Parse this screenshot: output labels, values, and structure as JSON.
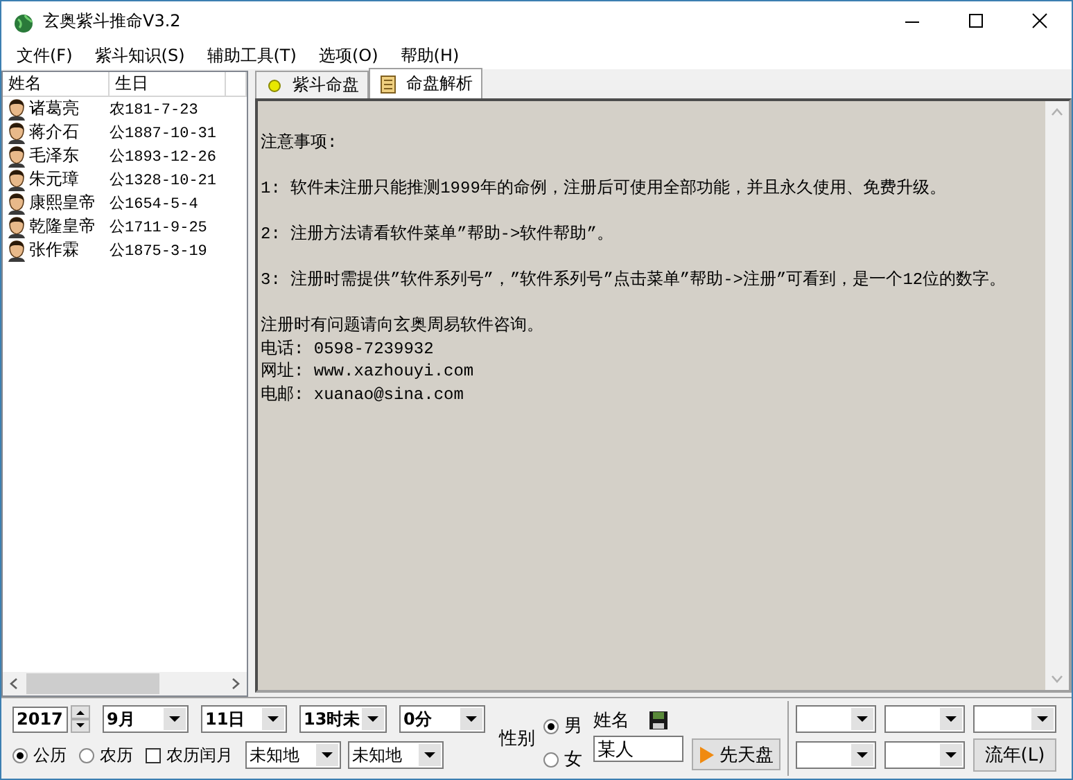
{
  "window": {
    "title": "玄奥紫斗推命V3.2"
  },
  "menu": [
    "文件(F)",
    "紫斗知识(S)",
    "辅助工具(T)",
    "选项(O)",
    "帮助(H)"
  ],
  "people_list": {
    "columns": [
      "姓名",
      "生日"
    ],
    "rows": [
      {
        "name": "诸葛亮",
        "birthday": "农181-7-23"
      },
      {
        "name": "蒋介石",
        "birthday": "公1887-10-31"
      },
      {
        "name": "毛泽东",
        "birthday": "公1893-12-26"
      },
      {
        "name": "朱元璋",
        "birthday": "公1328-10-21"
      },
      {
        "name": "康熙皇帝",
        "birthday": "公1654-5-4"
      },
      {
        "name": "乾隆皇帝",
        "birthday": "公1711-9-25"
      },
      {
        "name": "张作霖",
        "birthday": "公1875-3-19"
      }
    ]
  },
  "tabs": [
    {
      "label": "紫斗命盘",
      "selected": false
    },
    {
      "label": "命盘解析",
      "selected": true
    }
  ],
  "notice": [
    [
      "注意事项:"
    ],
    [
      "1: 软件未注册只能推测1999年的命例，注册后可使用全部功能，并且永久使用、免费升级。"
    ],
    [
      "2: 注册方法请看软件菜单”帮助->软件帮助”。"
    ],
    [
      "3: 注册时需提供”软件系列号”，”软件系列号”点击菜单”帮助->注册”可看到，是一个12位的数字。"
    ],
    [
      "注册时有问题请向玄奥周易软件咨询。",
      "电话: 0598-7239932",
      "网址: www.xazhouyi.com",
      "电邮: xuanao@sina.com"
    ]
  ],
  "date_input": {
    "year": "2017",
    "month": "9月",
    "day": "11日",
    "hour": "13时未",
    "minute": "0分",
    "calendar": [
      {
        "label": "公历",
        "selected": true
      },
      {
        "label": "农历",
        "selected": false
      }
    ],
    "leap_month": {
      "label": "农历闰月",
      "checked": false
    },
    "places": [
      "未知地",
      "未知地"
    ]
  },
  "gender": {
    "label": "性别",
    "options": [
      {
        "label": "男",
        "selected": true
      },
      {
        "label": "女",
        "selected": false
      }
    ]
  },
  "name_field": {
    "label": "姓名",
    "value": "某人"
  },
  "chart_button": "先天盘",
  "flow_button": "流年(L)"
}
